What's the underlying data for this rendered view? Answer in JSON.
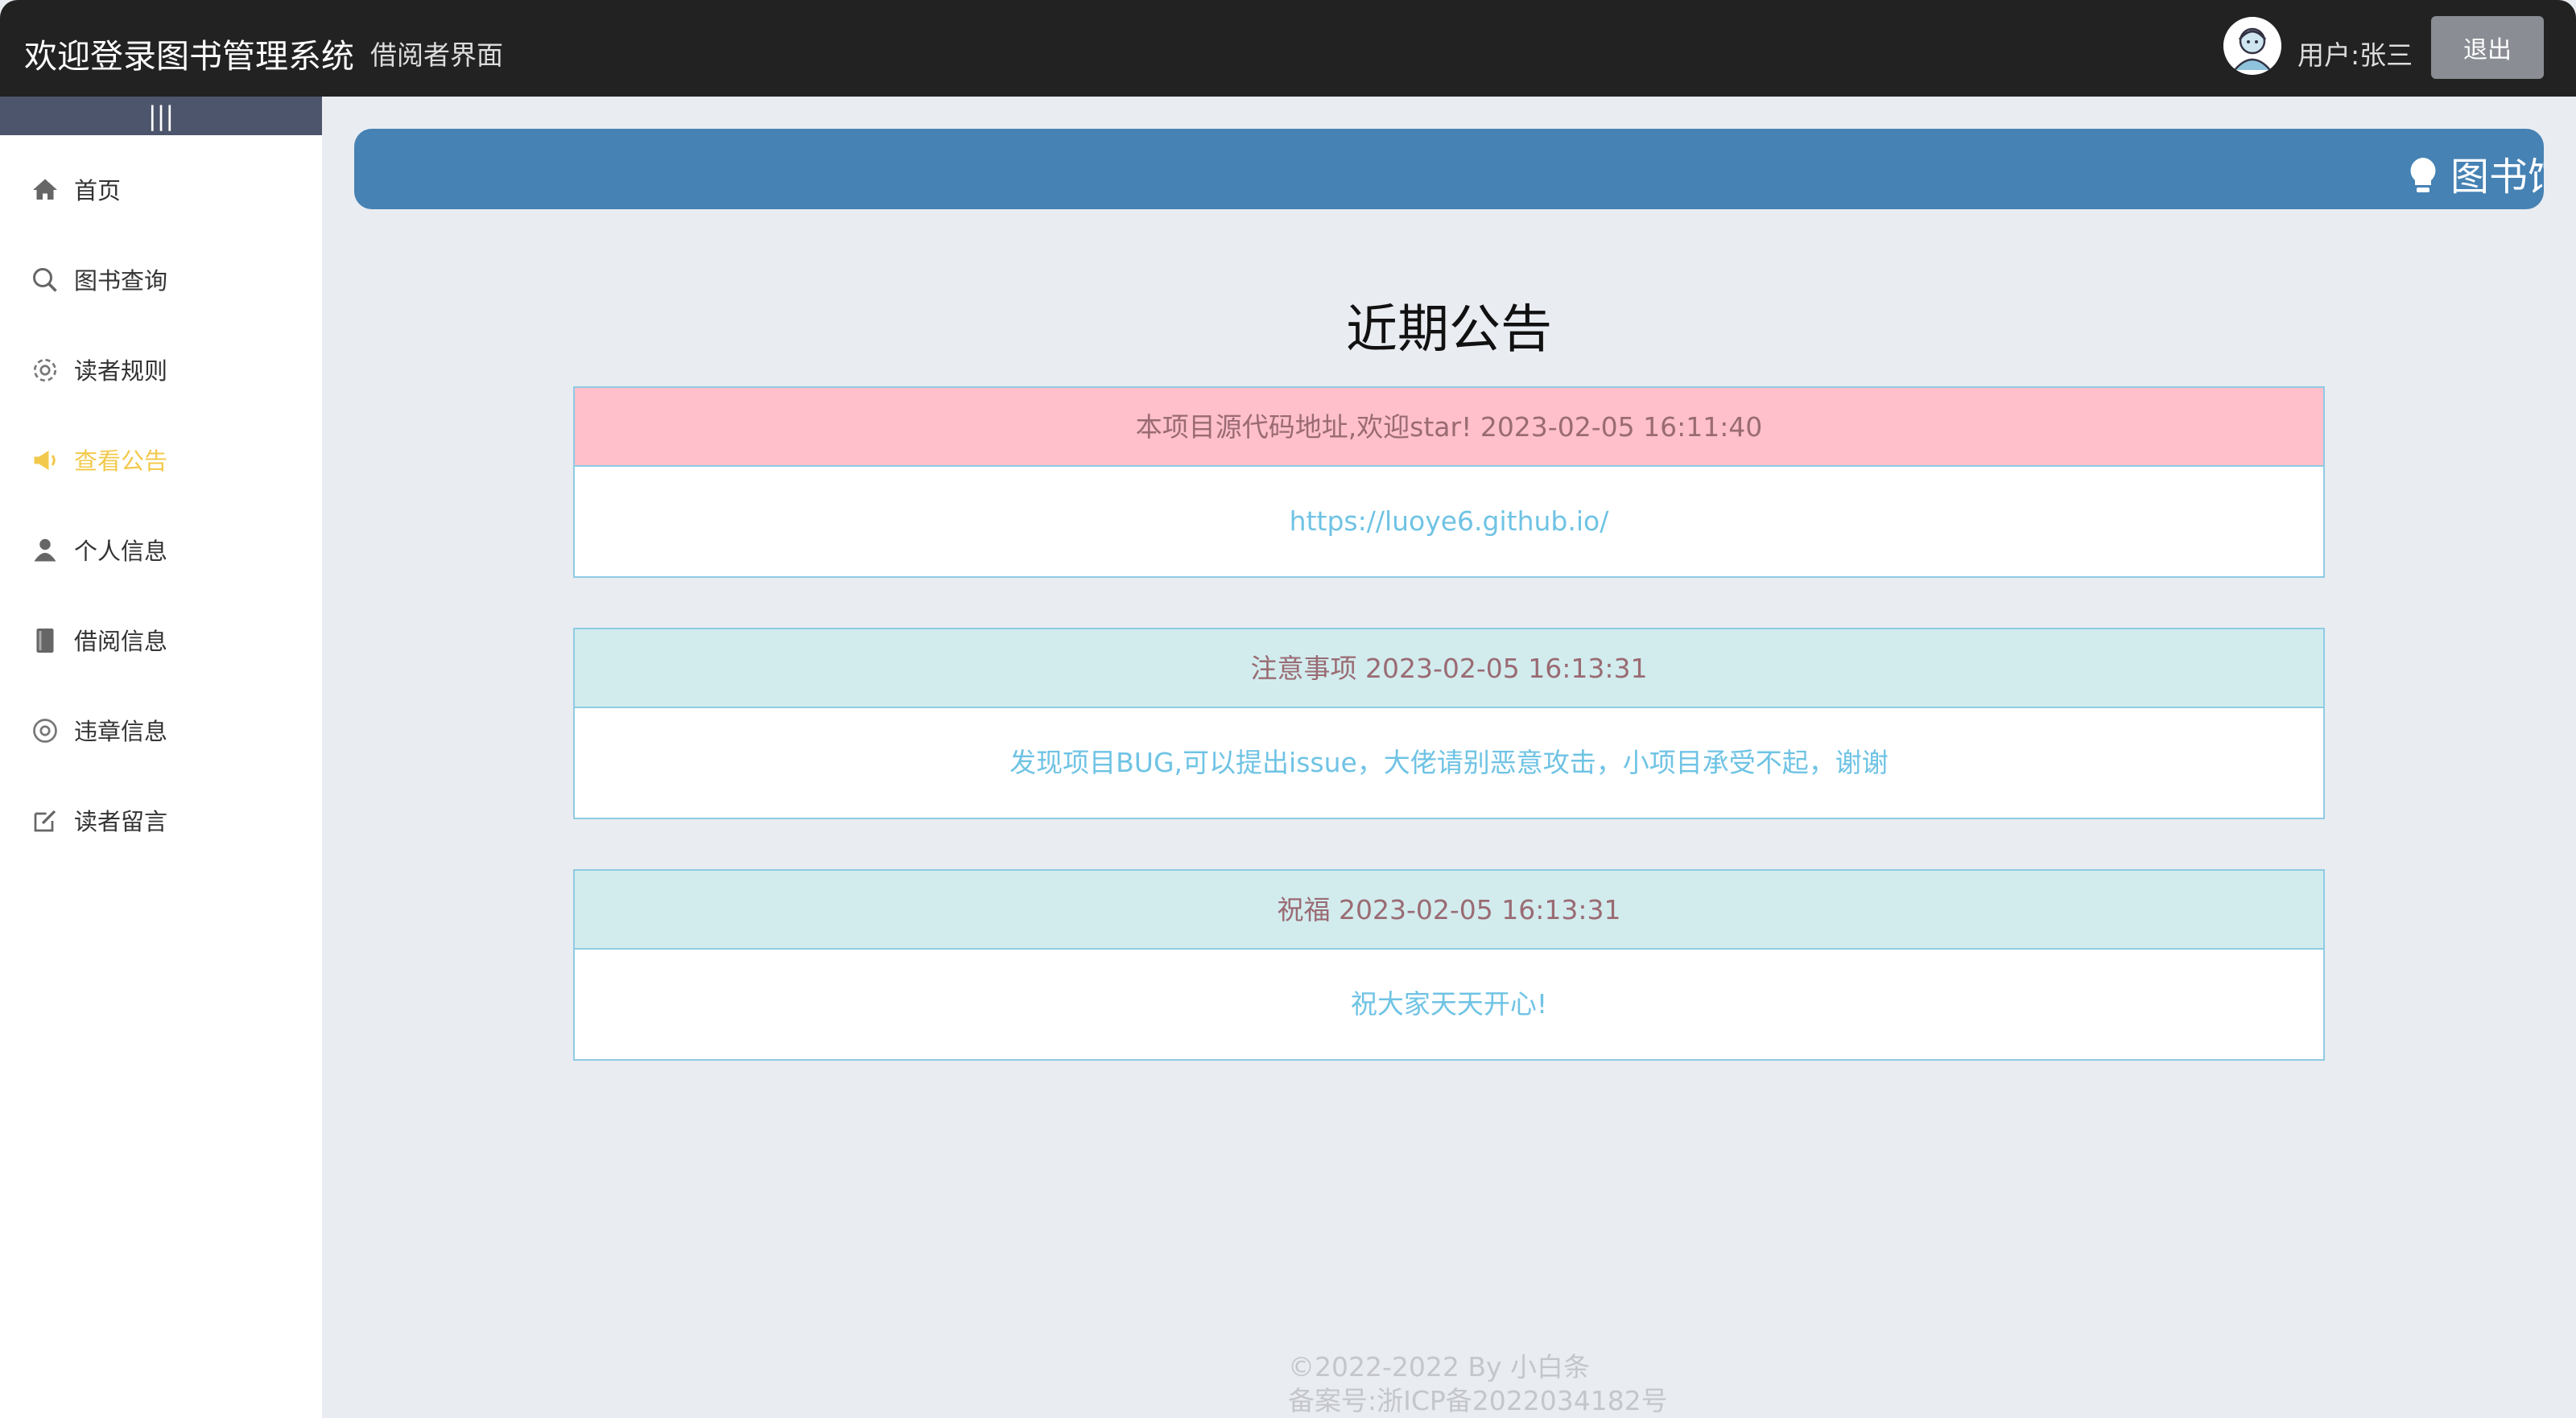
{
  "header": {
    "title": "欢迎登录图书管理系统",
    "subtitle": "借阅者界面",
    "user_label": "用户:张三",
    "logout_label": "退出"
  },
  "sidebar": {
    "collapse_icon": "|||",
    "items": [
      {
        "label": "首页",
        "icon": "home-icon"
      },
      {
        "label": "图书查询",
        "icon": "search-icon"
      },
      {
        "label": "读者规则",
        "icon": "gear-icon"
      },
      {
        "label": "查看公告",
        "icon": "megaphone-icon",
        "active": true
      },
      {
        "label": "个人信息",
        "icon": "user-icon"
      },
      {
        "label": "借阅信息",
        "icon": "book-icon"
      },
      {
        "label": "违章信息",
        "icon": "violation-icon"
      },
      {
        "label": "读者留言",
        "icon": "edit-icon"
      }
    ]
  },
  "banner": {
    "text": "图书馆"
  },
  "main": {
    "title": "近期公告",
    "announcements": [
      {
        "heading": "本项目源代码地址,欢迎star! 2023-02-05 16:11:40",
        "body": "https://luoye6.github.io/",
        "head_color": "#ffc0cb"
      },
      {
        "heading": "注意事项 2023-02-05 16:13:31",
        "body": "发现项目BUG,可以提出issue，大佬请别恶意攻击，小项目承受不起，谢谢",
        "head_color": "#d2ecee"
      },
      {
        "heading": "祝福 2023-02-05 16:13:31",
        "body": "祝大家天天开心!",
        "head_color": "#d2ecee"
      }
    ]
  },
  "footer": {
    "copyright": "©2022-2022 By 小白条",
    "icp": "备案号:浙ICP备2022034182号"
  },
  "colors": {
    "accent_active": "#f2c94c",
    "banner": "#4682b4",
    "header_bg": "#222222",
    "link": "#6fc3e4"
  }
}
